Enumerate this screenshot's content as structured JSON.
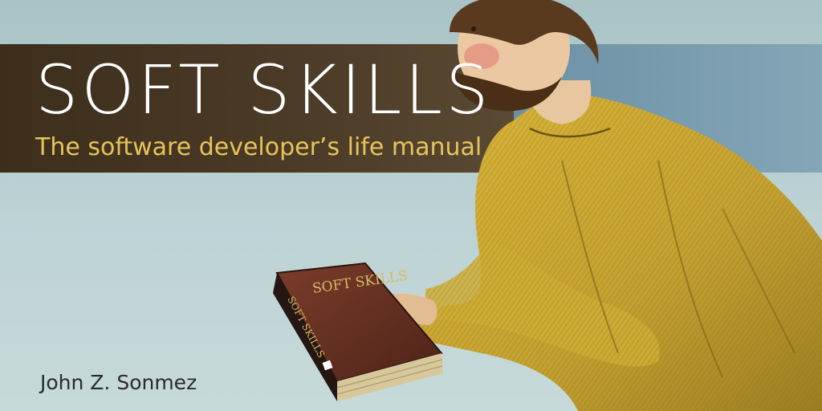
{
  "cover": {
    "title": "SOFT SKILLS",
    "subtitle": "The software developer’s life manual",
    "author": "John Z. Sonmez"
  },
  "book_in_hand": {
    "spine_title": "SOFT SKILLS",
    "front_title": "SOFT SKILLS"
  },
  "colors": {
    "band_dark": "#45362a",
    "band_light": "#7a9db0",
    "title_text": "#ffffff",
    "subtitle_text": "#e6c45a",
    "robe": "#c9a832",
    "background": "#b8cfd1"
  }
}
